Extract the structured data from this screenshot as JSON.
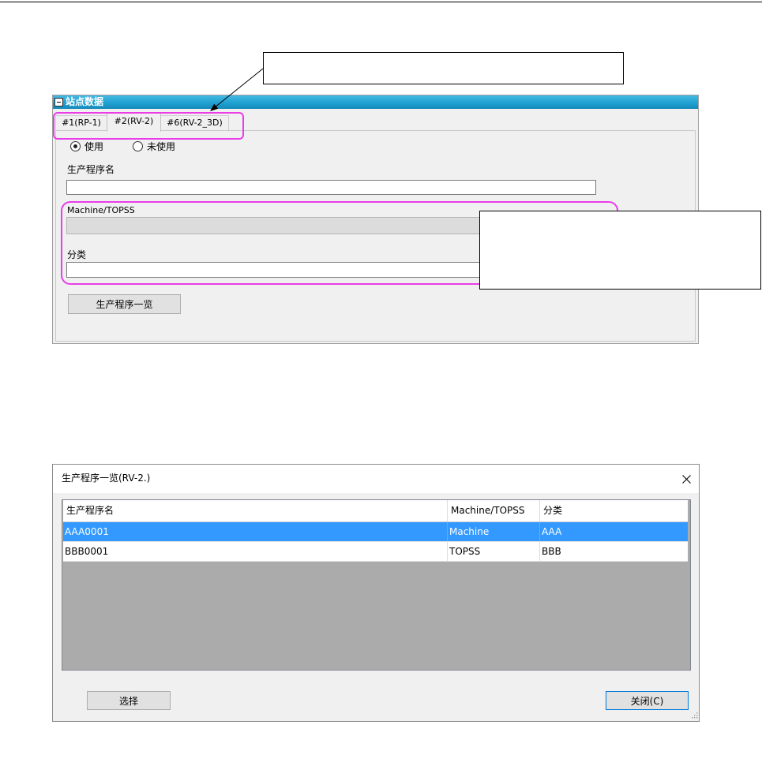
{
  "station_panel": {
    "title": "站点数据",
    "collapse_icon": "minus-icon",
    "tabs": [
      {
        "label": "#1(RP-1)",
        "selected": false
      },
      {
        "label": "#2(RV-2)",
        "selected": true
      },
      {
        "label": "#6(RV-2_3D)",
        "selected": false
      }
    ],
    "usage_options": [
      {
        "label": "使用",
        "selected": true
      },
      {
        "label": "未使用",
        "selected": false
      }
    ],
    "program_name": {
      "label": "生产程序名",
      "value": ""
    },
    "machine_topss": {
      "label": "Machine/TOPSS",
      "value": "",
      "enabled": false
    },
    "category": {
      "label": "分类",
      "value": ""
    },
    "program_list_button": "生产程序一览"
  },
  "program_list_dialog": {
    "title": "生产程序一览(RV-2.)",
    "close_icon": "close-icon",
    "columns": [
      "生产程序名",
      "Machine/TOPSS",
      "分类"
    ],
    "rows": [
      {
        "program_name": "AAA0001",
        "machine_topss": "Machine",
        "category": "AAA",
        "selected": true
      },
      {
        "program_name": "BBB0001",
        "machine_topss": "TOPSS",
        "category": "BBB",
        "selected": false
      }
    ],
    "select_button": "选择",
    "close_button": "关闭(C)",
    "resize_grip_icon": "resize-grip-icon"
  },
  "colors": {
    "panel_title_bar": "#1e9fd0",
    "highlight_outline": "#e83de8",
    "row_selection": "#3399ff",
    "grid_background": "#ababab",
    "default_button_border": "#0078d7"
  }
}
